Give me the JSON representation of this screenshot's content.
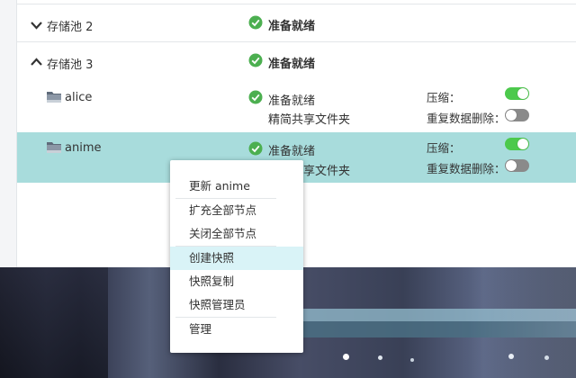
{
  "pools": [
    {
      "name": "存储池 2",
      "status": "准备就绪",
      "expanded": false
    },
    {
      "name": "存储池 3",
      "status": "准备就绪",
      "expanded": true
    }
  ],
  "shares": [
    {
      "name": "alice",
      "status": "准备就绪",
      "type": "精简共享文件夹",
      "compress_label": "压缩：",
      "compress_on": true,
      "dedup_label": "重复数据删除：",
      "dedup_on": false
    },
    {
      "name": "anime",
      "status": "准备就绪",
      "type_visible": "享文件夹",
      "compress_label": "压缩：",
      "compress_on": true,
      "dedup_label": "重复数据删除：",
      "dedup_on": false,
      "selected": true
    }
  ],
  "context_menu": {
    "items": [
      {
        "label": "更新 anime"
      },
      {
        "label": "扩充全部节点"
      },
      {
        "label": "关闭全部节点"
      },
      {
        "label": "创建快照",
        "highlighted": true
      },
      {
        "label": "快照复制"
      },
      {
        "label": "快照管理员"
      },
      {
        "label": "管理"
      }
    ]
  },
  "colors": {
    "selected_row": "#a8dcdc",
    "status_ok": "#4caf50",
    "toggle_on": "#4cc94c",
    "toggle_off": "#8a8a8a",
    "menu_highlight": "#d9f3f7"
  },
  "icons": [
    "chevron-down-icon",
    "chevron-up-icon",
    "check-circle-icon",
    "folder-icon"
  ]
}
